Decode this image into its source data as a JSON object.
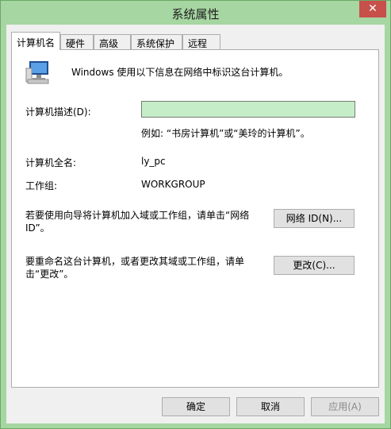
{
  "window": {
    "title": "系统属性",
    "close_glyph": "✕",
    "accent_color": "#a6d6a1"
  },
  "tabs": [
    {
      "label": "计算机名",
      "active": true
    },
    {
      "label": "硬件",
      "active": false
    },
    {
      "label": "高级",
      "active": false
    },
    {
      "label": "系统保护",
      "active": false
    },
    {
      "label": "远程",
      "active": false
    }
  ],
  "panel": {
    "icon": "computer-icon",
    "intro": "Windows 使用以下信息在网络中标识这台计算机。",
    "description_label": "计算机描述(D):",
    "description_value": "",
    "description_example": "例如: “书房计算机”或“美玲的计算机”。",
    "full_name_label": "计算机全名:",
    "full_name_value": "ly_pc",
    "workgroup_label": "工作组:",
    "workgroup_value": "WORKGROUP",
    "network_id_text": "若要使用向导将计算机加入域或工作组，请单击“网络 ID”。",
    "network_id_button": "网络 ID(N)...",
    "rename_text": "要重命名这台计算机，或者更改其域或工作组，请单击“更改”。",
    "change_button": "更改(C)..."
  },
  "buttons": {
    "ok": "确定",
    "cancel": "取消",
    "apply": "应用(A)"
  }
}
